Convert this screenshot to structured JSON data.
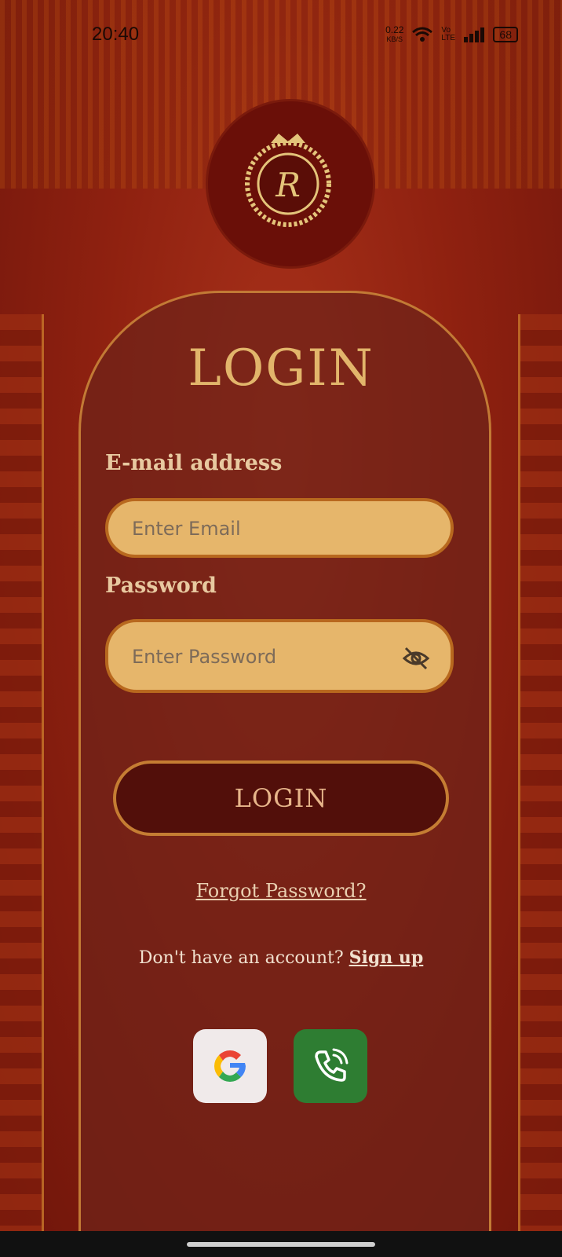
{
  "status_bar": {
    "time": "20:40",
    "net_speed": "0.22",
    "net_unit": "KB/S",
    "volte": "Vo LTE",
    "battery": "68"
  },
  "logo": {
    "monogram": "R"
  },
  "login_title": "LOGIN",
  "email": {
    "label": "E-mail address",
    "placeholder": "Enter Email"
  },
  "password": {
    "label": "Password",
    "placeholder": "Enter Password",
    "toggle_icon": "eye-off-icon"
  },
  "login_button": "LOGIN",
  "forgot_password": "Forgot Password?",
  "signup": {
    "prompt": "Don't have an account? ",
    "link": "Sign up"
  },
  "social": [
    {
      "name": "google",
      "icon": "google-icon"
    },
    {
      "name": "phone",
      "icon": "phone-icon"
    }
  ],
  "colors": {
    "background": "#8f2110",
    "panel_border": "#c27a35",
    "field_fill": "#e6b66b",
    "button_fill": "#520f0a",
    "title_gold": "#e2b56b",
    "phone_green": "#2e7d32"
  }
}
